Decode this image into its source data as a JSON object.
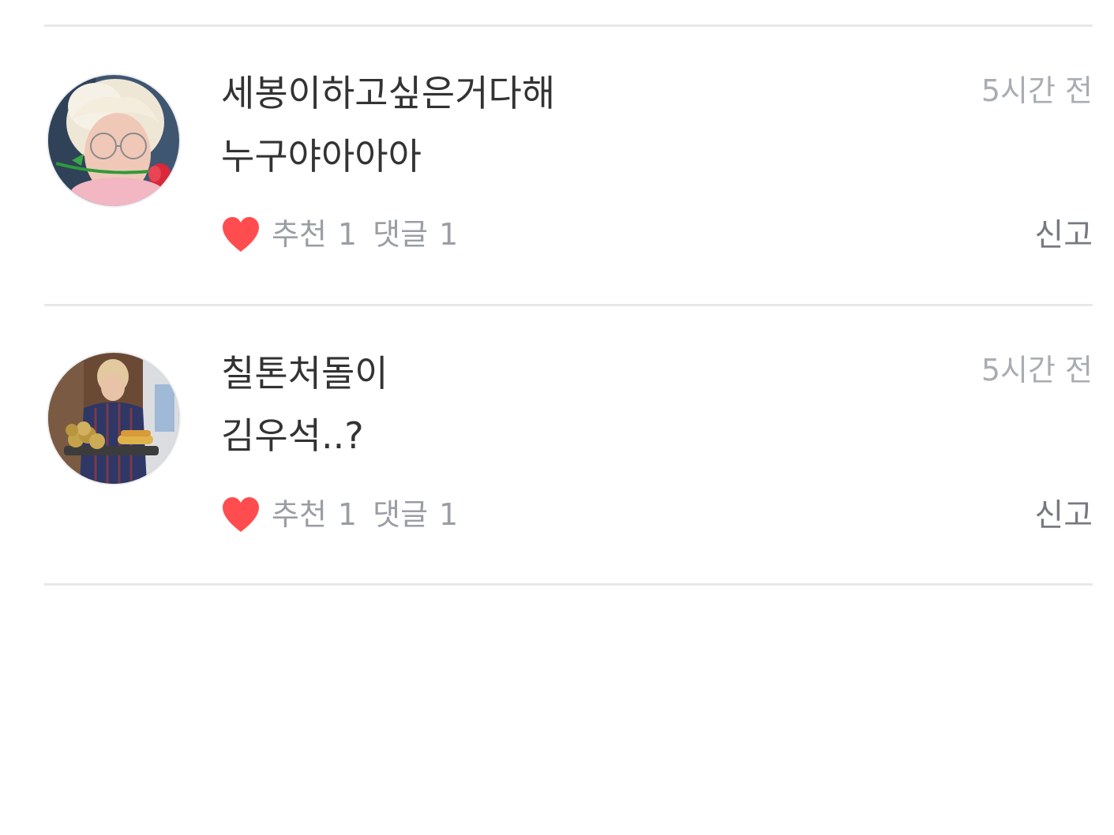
{
  "colors": {
    "heart": "#ff4d4f",
    "divider": "#e8e8e8",
    "meta_text": "#a9adb3"
  },
  "comments": [
    {
      "username": "세봉이하고싶은거다해",
      "time": "5시간 전",
      "text": "누구야아아아",
      "like_label": "추천",
      "like_count": "1",
      "reply_label": "댓글",
      "reply_count": "1",
      "report_label": "신고",
      "avatar_icon": "avatar-photo-blond-rose"
    },
    {
      "username": "칠톤처돌이",
      "time": "5시간 전",
      "text": "김우석..?",
      "like_label": "추천",
      "like_count": "1",
      "reply_label": "댓글",
      "reply_count": "1",
      "report_label": "신고",
      "avatar_icon": "avatar-photo-tray-fruit"
    }
  ]
}
